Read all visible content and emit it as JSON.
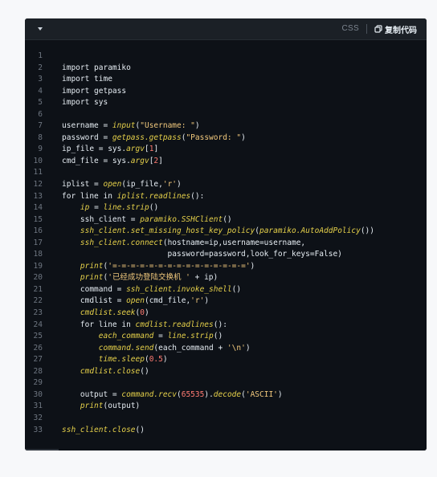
{
  "toolbar": {
    "language": "CSS",
    "copy_label": "复制代码",
    "collapse_icon": "chevron-down-icon",
    "copy_icon": "copy-icon"
  },
  "colors": {
    "background": "#0d1117",
    "function": "#e6d14a",
    "string": "#f2c97d",
    "number": "#ff7b72",
    "text": "#e6edf3",
    "line_number": "#6e7681"
  },
  "code": {
    "lines": [
      {
        "n": "1",
        "t": []
      },
      {
        "n": "2",
        "t": [
          [
            "import paramiko",
            "p"
          ]
        ]
      },
      {
        "n": "3",
        "t": [
          [
            "import time",
            "p"
          ]
        ]
      },
      {
        "n": "4",
        "t": [
          [
            "import getpass",
            "p"
          ]
        ]
      },
      {
        "n": "5",
        "t": [
          [
            "import sys",
            "p"
          ]
        ]
      },
      {
        "n": "6",
        "t": []
      },
      {
        "n": "7",
        "t": [
          [
            "username = ",
            "p"
          ],
          [
            "input",
            "f"
          ],
          [
            "(",
            "p"
          ],
          [
            "\"Username: \"",
            "s"
          ],
          [
            ")",
            "p"
          ]
        ]
      },
      {
        "n": "8",
        "t": [
          [
            "password = ",
            "p"
          ],
          [
            "getpass.getpass",
            "f"
          ],
          [
            "(",
            "p"
          ],
          [
            "\"Password: \"",
            "s"
          ],
          [
            ")",
            "p"
          ]
        ]
      },
      {
        "n": "9",
        "t": [
          [
            "ip_file = sys.",
            "p"
          ],
          [
            "argv",
            "f"
          ],
          [
            "[",
            "p"
          ],
          [
            "1",
            "n"
          ],
          [
            "]",
            "p"
          ]
        ]
      },
      {
        "n": "10",
        "t": [
          [
            "cmd_file = sys.",
            "p"
          ],
          [
            "argv",
            "f"
          ],
          [
            "[",
            "p"
          ],
          [
            "2",
            "n"
          ],
          [
            "]",
            "p"
          ]
        ]
      },
      {
        "n": "11",
        "t": []
      },
      {
        "n": "12",
        "t": [
          [
            "iplist = ",
            "p"
          ],
          [
            "open",
            "f"
          ],
          [
            "(ip_file,",
            "p"
          ],
          [
            "'r'",
            "s"
          ],
          [
            ")",
            "p"
          ]
        ]
      },
      {
        "n": "13",
        "t": [
          [
            "for line in ",
            "p"
          ],
          [
            "iplist.readlines",
            "f"
          ],
          [
            "():",
            "p"
          ]
        ]
      },
      {
        "n": "14",
        "t": [
          [
            "    ",
            "p"
          ],
          [
            "ip",
            "f"
          ],
          [
            " = ",
            "p"
          ],
          [
            "line.strip",
            "f"
          ],
          [
            "()",
            "p"
          ]
        ]
      },
      {
        "n": "15",
        "t": [
          [
            "    ssh_client = ",
            "p"
          ],
          [
            "paramiko.SSHClient",
            "f"
          ],
          [
            "()",
            "p"
          ]
        ]
      },
      {
        "n": "16",
        "t": [
          [
            "    ",
            "p"
          ],
          [
            "ssh_client.set_missing_host_key_policy",
            "f"
          ],
          [
            "(",
            "p"
          ],
          [
            "paramiko.AutoAddPolicy",
            "f"
          ],
          [
            "())",
            "p"
          ]
        ]
      },
      {
        "n": "17",
        "t": [
          [
            "    ",
            "p"
          ],
          [
            "ssh_client.connect",
            "f"
          ],
          [
            "(hostname=ip,username=username,",
            "p"
          ]
        ]
      },
      {
        "n": "18",
        "t": [
          [
            "                       password=password,look_for_keys=False)",
            "p"
          ]
        ]
      },
      {
        "n": "19",
        "t": [
          [
            "    ",
            "p"
          ],
          [
            "print",
            "f"
          ],
          [
            "(",
            "p"
          ],
          [
            "'=-=-=-=-=-=-=-=-=-=-=-=-=-=-='",
            "s"
          ],
          [
            ")",
            "p"
          ]
        ]
      },
      {
        "n": "20",
        "t": [
          [
            "    ",
            "p"
          ],
          [
            "print",
            "f"
          ],
          [
            "(",
            "p"
          ],
          [
            "'已经成功登陆交换机 '",
            "s"
          ],
          [
            " + ip)",
            "p"
          ]
        ]
      },
      {
        "n": "21",
        "t": [
          [
            "    command = ",
            "p"
          ],
          [
            "ssh_client.invoke_shell",
            "f"
          ],
          [
            "()",
            "p"
          ]
        ]
      },
      {
        "n": "22",
        "t": [
          [
            "    cmdlist = ",
            "p"
          ],
          [
            "open",
            "f"
          ],
          [
            "(cmd_file,",
            "p"
          ],
          [
            "'r'",
            "s"
          ],
          [
            ")",
            "p"
          ]
        ]
      },
      {
        "n": "23",
        "t": [
          [
            "    ",
            "p"
          ],
          [
            "cmdlist.seek",
            "f"
          ],
          [
            "(",
            "p"
          ],
          [
            "0",
            "n"
          ],
          [
            ")",
            "p"
          ]
        ]
      },
      {
        "n": "24",
        "t": [
          [
            "    for line in ",
            "p"
          ],
          [
            "cmdlist.readlines",
            "f"
          ],
          [
            "():",
            "p"
          ]
        ]
      },
      {
        "n": "25",
        "t": [
          [
            "        ",
            "p"
          ],
          [
            "each_command",
            "f"
          ],
          [
            " = ",
            "p"
          ],
          [
            "line.strip",
            "f"
          ],
          [
            "()",
            "p"
          ]
        ]
      },
      {
        "n": "26",
        "t": [
          [
            "        ",
            "p"
          ],
          [
            "command.send",
            "f"
          ],
          [
            "(each_command + ",
            "p"
          ],
          [
            "'\\n'",
            "s"
          ],
          [
            ")",
            "p"
          ]
        ]
      },
      {
        "n": "27",
        "t": [
          [
            "        ",
            "p"
          ],
          [
            "time.sleep",
            "f"
          ],
          [
            "(",
            "p"
          ],
          [
            "0.5",
            "n"
          ],
          [
            ")",
            "p"
          ]
        ]
      },
      {
        "n": "28",
        "t": [
          [
            "    ",
            "p"
          ],
          [
            "cmdlist.close",
            "f"
          ],
          [
            "()",
            "p"
          ]
        ]
      },
      {
        "n": "29",
        "t": []
      },
      {
        "n": "30",
        "t": [
          [
            "    output = ",
            "p"
          ],
          [
            "command.recv",
            "f"
          ],
          [
            "(",
            "p"
          ],
          [
            "65535",
            "n"
          ],
          [
            ").",
            "p"
          ],
          [
            "decode",
            "f"
          ],
          [
            "(",
            "p"
          ],
          [
            "'ASCII'",
            "s"
          ],
          [
            ")",
            "p"
          ]
        ]
      },
      {
        "n": "31",
        "t": [
          [
            "    ",
            "p"
          ],
          [
            "print",
            "f"
          ],
          [
            "(output)",
            "p"
          ]
        ]
      },
      {
        "n": "32",
        "t": []
      },
      {
        "n": "33",
        "t": [
          [
            "ssh_client.close",
            "f"
          ],
          [
            "()",
            "p"
          ]
        ]
      }
    ]
  }
}
